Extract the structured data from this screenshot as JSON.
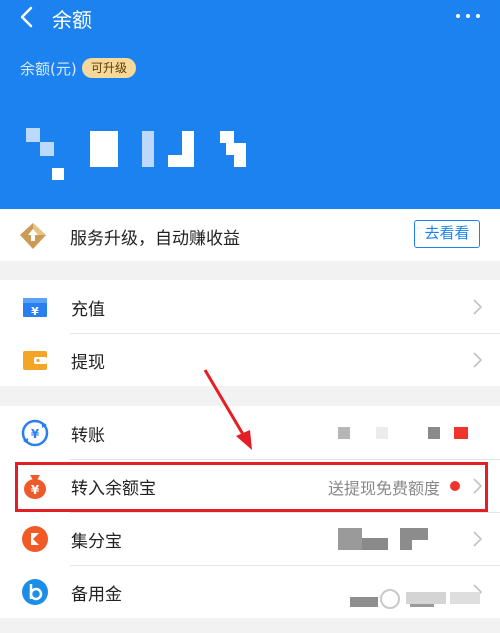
{
  "header": {
    "title": "余额",
    "balance_label": "余额(元)",
    "upgrade_badge": "可升级",
    "accent_color": "#1b82f0"
  },
  "promo": {
    "text": "服务升级，自动赚收益",
    "button": "去看看"
  },
  "group1": {
    "items": [
      {
        "label": "充值",
        "icon": "recharge-icon"
      },
      {
        "label": "提现",
        "icon": "withdraw-wallet-icon"
      }
    ]
  },
  "group2": {
    "items": [
      {
        "label": "转账",
        "icon": "transfer-icon"
      },
      {
        "label": "转入余额宝",
        "hint": "送提现免费额度",
        "icon": "money-bag-icon",
        "badge_color": "#f0332b"
      },
      {
        "label": "集分宝",
        "icon": "jifenbao-icon"
      },
      {
        "label": "备用金",
        "icon": "beiyongjin-icon"
      }
    ]
  },
  "annotation": {
    "highlight_color": "#e31e24"
  }
}
